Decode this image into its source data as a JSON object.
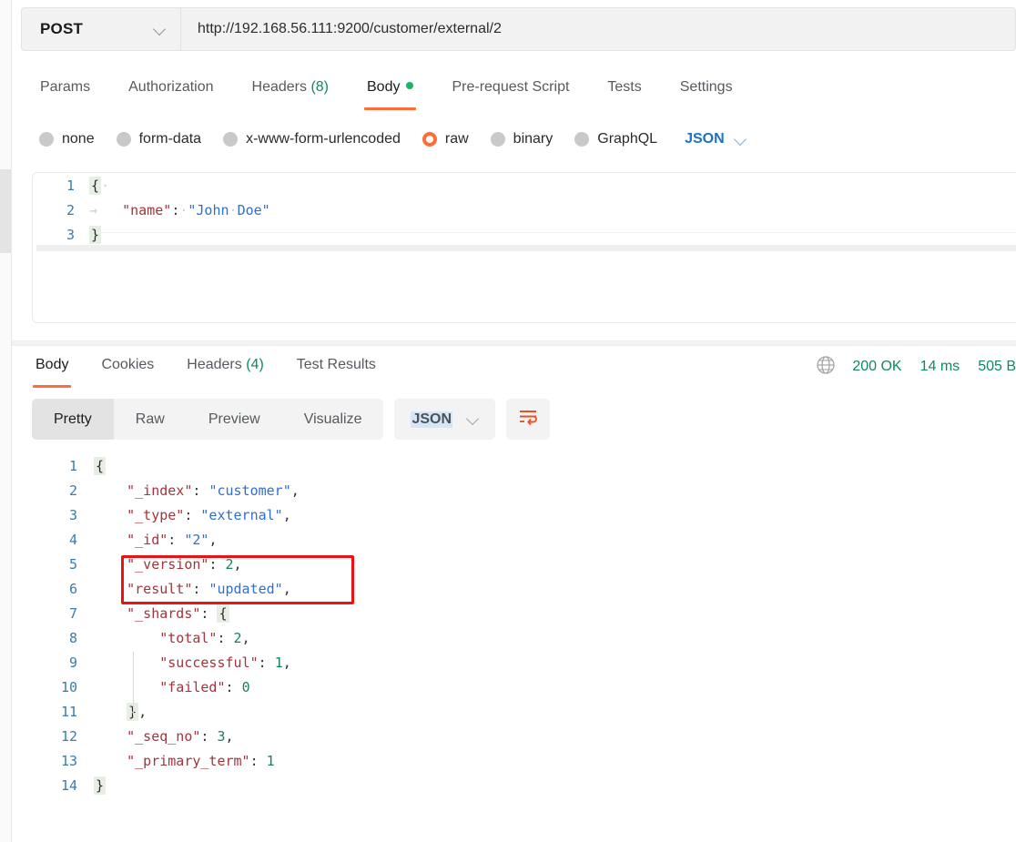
{
  "request": {
    "method": "POST",
    "method_chevron_icon": "chevron-down-icon",
    "url": "http://192.168.56.111:9200/customer/external/2",
    "tabs": [
      {
        "label": "Params",
        "active": false
      },
      {
        "label": "Authorization",
        "active": false
      },
      {
        "label": "Headers",
        "count": "(8)",
        "active": false
      },
      {
        "label": "Body",
        "active": true,
        "has_dot": true
      },
      {
        "label": "Pre-request Script",
        "active": false
      },
      {
        "label": "Tests",
        "active": false
      },
      {
        "label": "Settings",
        "active": false
      }
    ],
    "body_types": [
      {
        "label": "none",
        "selected": false
      },
      {
        "label": "form-data",
        "selected": false
      },
      {
        "label": "x-www-form-urlencoded",
        "selected": false
      },
      {
        "label": "raw",
        "selected": true
      },
      {
        "label": "binary",
        "selected": false
      },
      {
        "label": "GraphQL",
        "selected": false
      }
    ],
    "raw_format": "JSON",
    "raw_format_chevron_icon": "chevron-down-icon",
    "editor_lines": [
      {
        "n": "1",
        "text": "{"
      },
      {
        "n": "2",
        "text": "    \"name\": \"John Doe\""
      },
      {
        "n": "3",
        "text": "}"
      }
    ]
  },
  "response": {
    "tabs": [
      {
        "label": "Body",
        "active": true
      },
      {
        "label": "Cookies",
        "active": false
      },
      {
        "label": "Headers",
        "count": "(4)",
        "active": false
      },
      {
        "label": "Test Results",
        "active": false
      }
    ],
    "globe_icon": "globe-icon",
    "status": "200 OK",
    "time": "14 ms",
    "size": "505 B",
    "view_modes": [
      {
        "label": "Pretty",
        "active": true
      },
      {
        "label": "Raw",
        "active": false
      },
      {
        "label": "Preview",
        "active": false
      },
      {
        "label": "Visualize",
        "active": false
      }
    ],
    "format": "JSON",
    "format_chevron_icon": "chevron-down-icon",
    "wrap_icon": "wrap-lines-icon",
    "body_lines": [
      {
        "n": "1",
        "text": "{"
      },
      {
        "n": "2",
        "text": "    \"_index\": \"customer\","
      },
      {
        "n": "3",
        "text": "    \"_type\": \"external\","
      },
      {
        "n": "4",
        "text": "    \"_id\": \"2\","
      },
      {
        "n": "5",
        "text": "    \"_version\": 2,"
      },
      {
        "n": "6",
        "text": "    \"result\": \"updated\","
      },
      {
        "n": "7",
        "text": "    \"_shards\": {"
      },
      {
        "n": "8",
        "text": "        \"total\": 2,"
      },
      {
        "n": "9",
        "text": "        \"successful\": 1,"
      },
      {
        "n": "10",
        "text": "        \"failed\": 0"
      },
      {
        "n": "11",
        "text": "    },"
      },
      {
        "n": "12",
        "text": "    \"_seq_no\": 3,"
      },
      {
        "n": "13",
        "text": "    \"_primary_term\": 1"
      },
      {
        "n": "14",
        "text": "}"
      }
    ],
    "annotation": {
      "highlighted_lines": [
        "5",
        "6"
      ],
      "color": "#ee1111"
    }
  },
  "colors": {
    "accent": "#ff6c37",
    "success": "#0f8a5f",
    "json_key": "#a4343a",
    "json_string": "#2f6fd0",
    "json_number": "#1a7f5a",
    "line_number": "#3a7ca8"
  }
}
